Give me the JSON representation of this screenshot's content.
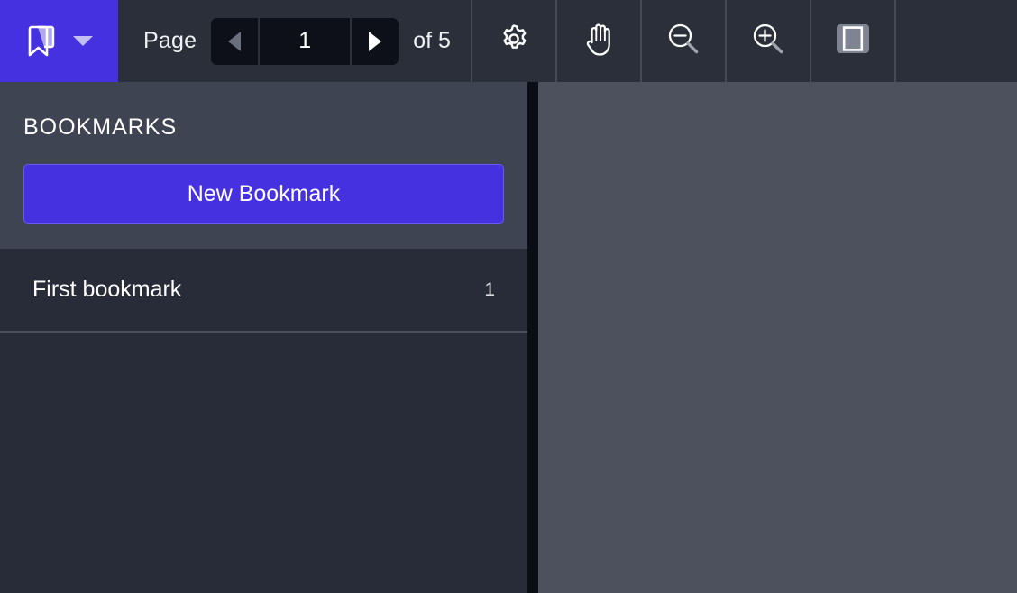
{
  "toolbar": {
    "bookmark_tab": {
      "icon": "bookmark-icon",
      "dropdown_icon": "chevron-down-icon"
    },
    "page_label": "Page",
    "page_value": "1",
    "page_total": "of 5",
    "prev_icon": "triangle-left-icon",
    "next_icon": "triangle-right-icon",
    "buttons": [
      {
        "name": "settings-button",
        "icon": "gear-icon"
      },
      {
        "name": "pan-button",
        "icon": "hand-icon"
      },
      {
        "name": "zoom-out-button",
        "icon": "magnifier-minus-icon"
      },
      {
        "name": "zoom-in-button",
        "icon": "magnifier-plus-icon"
      },
      {
        "name": "page-layout-button",
        "icon": "single-page-view-icon"
      }
    ]
  },
  "sidebar": {
    "title": "BOOKMARKS",
    "new_bookmark_label": "New Bookmark",
    "bookmarks": [
      {
        "label": "First bookmark",
        "page": "1"
      }
    ]
  },
  "colors": {
    "accent": "#4631e0",
    "toolbar_bg": "#2b2f3a",
    "sidebar_header_bg": "#3f4453",
    "sidebar_list_bg": "#282c38",
    "viewer_bg": "#4d515e",
    "page_box_bg": "#0d1018"
  }
}
